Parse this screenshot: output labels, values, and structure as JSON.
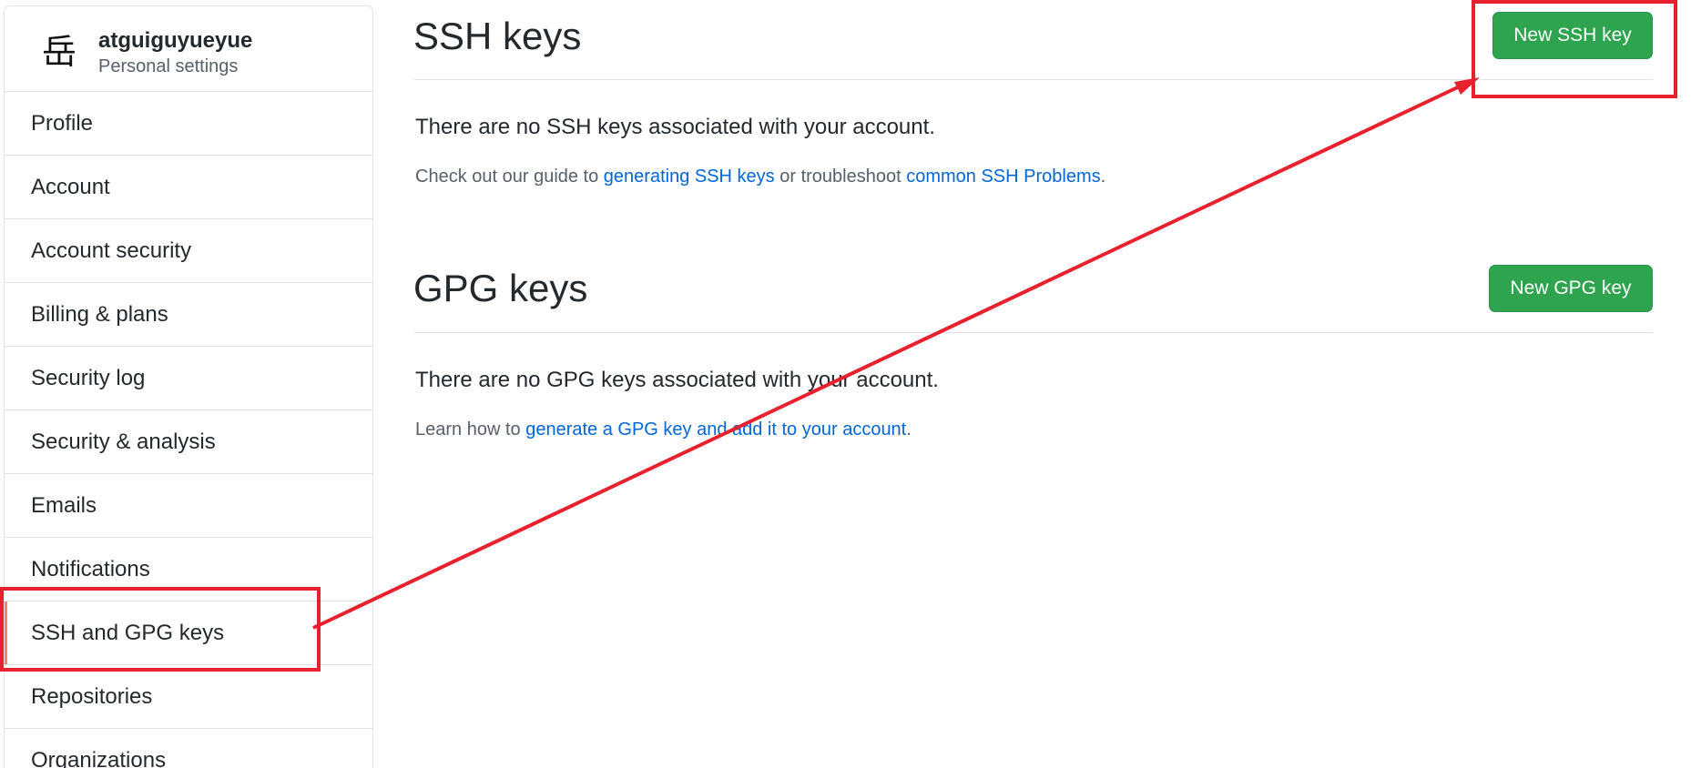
{
  "user": {
    "avatar_glyph": "岳",
    "name": "atguiguyueyue",
    "subtitle": "Personal settings"
  },
  "sidebar": {
    "items": [
      {
        "label": "Profile"
      },
      {
        "label": "Account"
      },
      {
        "label": "Account security"
      },
      {
        "label": "Billing & plans"
      },
      {
        "label": "Security log"
      },
      {
        "label": "Security & analysis"
      },
      {
        "label": "Emails"
      },
      {
        "label": "Notifications"
      },
      {
        "label": "SSH and GPG keys",
        "selected": true
      },
      {
        "label": "Repositories"
      },
      {
        "label": "Organizations"
      }
    ]
  },
  "ssh": {
    "title": "SSH keys",
    "button": "New SSH key",
    "empty": "There are no SSH keys associated with your account.",
    "help_prefix": "Check out our guide to ",
    "help_link1": "generating SSH keys",
    "help_middle": " or troubleshoot ",
    "help_link2": "common SSH Problems",
    "help_suffix": "."
  },
  "gpg": {
    "title": "GPG keys",
    "button": "New GPG key",
    "empty": "There are no GPG keys associated with your account.",
    "help_prefix": "Learn how to ",
    "help_link": "generate a GPG key and add it to your account",
    "help_suffix": "."
  },
  "colors": {
    "accent_green": "#2ea44f",
    "link_blue": "#0366d6",
    "selected_marker": "#f9826c",
    "annotation_red": "#e8212e"
  }
}
